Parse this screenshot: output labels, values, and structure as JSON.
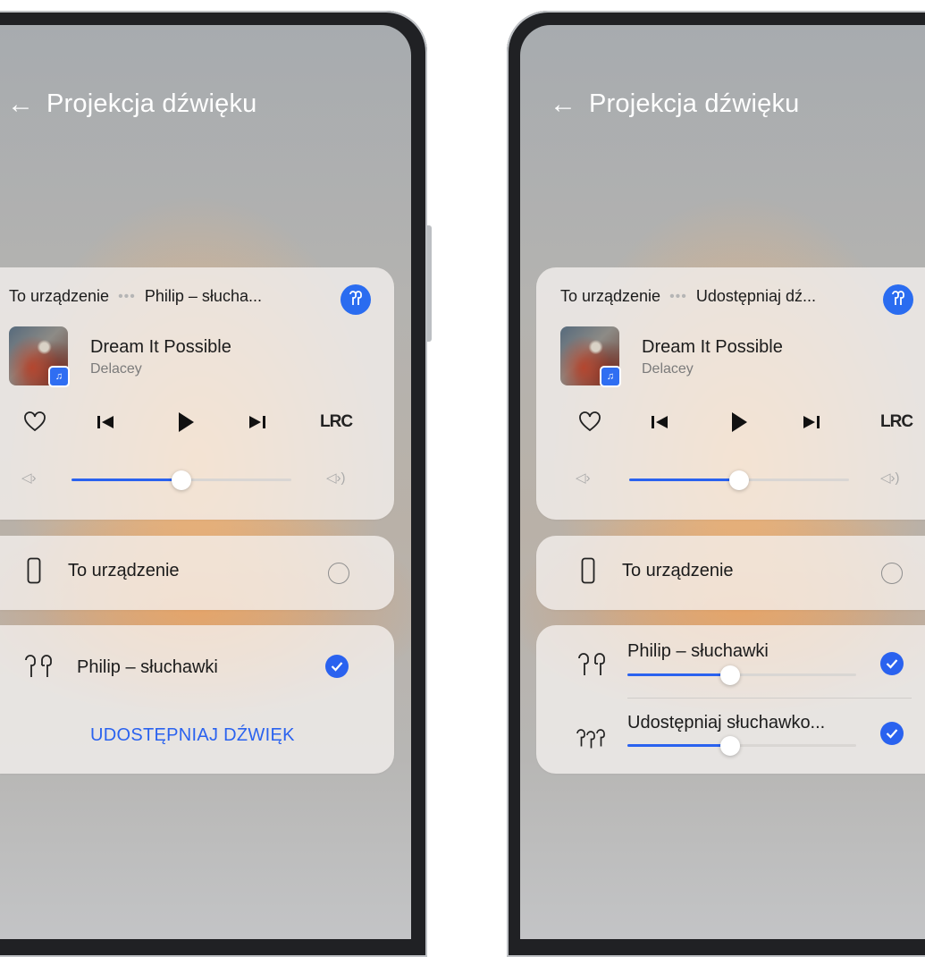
{
  "left": {
    "header": {
      "back_icon": "arrow-left-icon",
      "title": "Projekcja dźwięku"
    },
    "player": {
      "route_from": "To urządzenie",
      "route_sep": "•••",
      "route_to": "Philip – słucha...",
      "badge_icon": "earbuds-icon",
      "song_title": "Dream It Possible",
      "artist": "Delacey",
      "lrc_label": "LRC",
      "volume_level": 0.5
    },
    "device_this": {
      "label": "To urządzenie"
    },
    "device_headphones": {
      "label": "Philip – słuchawki"
    },
    "share_button": "UDOSTĘPNIAJ DŹWIĘK"
  },
  "right": {
    "header": {
      "back_icon": "arrow-left-icon",
      "title": "Projekcja dźwięku"
    },
    "player": {
      "route_from": "To urządzenie",
      "route_sep": "•••",
      "route_to": "Udostępniaj dź...",
      "badge_icon": "earbuds-icon",
      "song_title": "Dream It Possible",
      "artist": "Delacey",
      "lrc_label": "LRC",
      "volume_level": 0.5
    },
    "device_this": {
      "label": "To urządzenie"
    },
    "device_headphones": {
      "label": "Philip – słuchawki",
      "volume_level": 0.45
    },
    "device_shared": {
      "label": "Udostępniaj słuchawko...",
      "volume_level": 0.45
    }
  },
  "colors": {
    "accent": "#2a62ef",
    "badge": "#2a6cf0"
  }
}
